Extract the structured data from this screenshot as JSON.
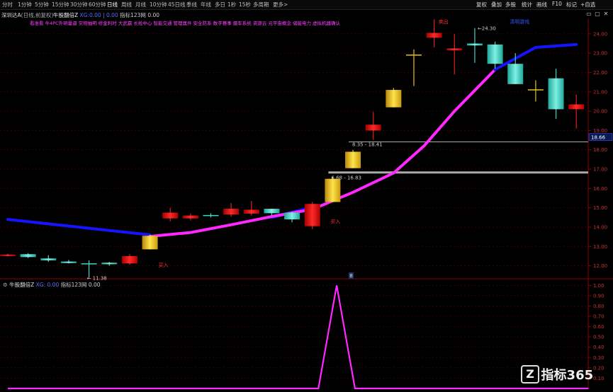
{
  "toolbar": {
    "periods": [
      "分时",
      "1分钟",
      "5分钟",
      "15分钟",
      "30分钟",
      "60分钟",
      "日线",
      "周线",
      "月线",
      "10分钟",
      "45日线",
      "季线",
      "年线",
      "多日",
      "1秒",
      "15秒",
      "多周期",
      "更多>"
    ],
    "active_period": "日线",
    "right_buttons": [
      "复权",
      "叠加",
      "多股",
      "统计",
      "画线",
      "F10",
      "标记",
      "+自选"
    ],
    "window_buttons": [
      "▭",
      "▢",
      "✕"
    ]
  },
  "header": {
    "stock_name": "深圳达A",
    "period_note": "(日线,前复权)",
    "indicator_name": "牛股翻倍Z",
    "indicator_values": "XG:0.00 | 0.00",
    "subindicator": "指标123网",
    "sub_value": "0.00",
    "marquee": "看准看 牛4PC外研量逼 实物抽明 修金利时 大武赢 长抢中心 智能交通 管理属件 安全防系 数字赛事 摄车系统 资源云 元宇宙概念 储能电力 虚拟机器确认"
  },
  "main_axis": {
    "ticks": [
      "24.00",
      "23.00",
      "22.00",
      "21.00",
      "20.00",
      "19.00",
      "18.00",
      "17.00",
      "16.00",
      "15.00",
      "14.00",
      "13.00",
      "12.00"
    ],
    "current_price": "18.66"
  },
  "lower": {
    "title": "牛股翻倍Z",
    "value_text": "XG: 0.00",
    "sub": "指标123网",
    "sub_value": "0.00",
    "ticks": [
      "1.00",
      "0.90",
      "0.80",
      "0.70",
      "0.60",
      "0.50",
      "0.40",
      "0.30",
      "0.20",
      "0.10"
    ]
  },
  "annotations": {
    "low_label": "← 11.38",
    "high_label": "←24.30",
    "range1": "8.35 - 18.41",
    "range2": "6.68 - 16.83",
    "buy1": "买入",
    "buy2": "买入",
    "sell": "卖出",
    "top_note": "清明游戏",
    "center_marker": "8"
  },
  "watermark": {
    "text": "指标365"
  },
  "colors": {
    "up": "#e0201e",
    "down": "#40d6c8",
    "gold": "#e8c21a",
    "trend_blue": "#1414ff",
    "trend_pink": "#ff28ff",
    "axis": "#8b0000"
  },
  "chart_data": {
    "type": "candlestick",
    "ylim": [
      11.4,
      24.8
    ],
    "lower_ylim": [
      0,
      1.05
    ],
    "candles": [
      {
        "o": 12.55,
        "h": 12.62,
        "l": 12.48,
        "c": 12.58,
        "kind": "up"
      },
      {
        "o": 12.6,
        "h": 12.65,
        "l": 12.4,
        "c": 12.45,
        "kind": "down"
      },
      {
        "o": 12.38,
        "h": 12.55,
        "l": 12.2,
        "c": 12.28,
        "kind": "down"
      },
      {
        "o": 12.22,
        "h": 12.3,
        "l": 12.12,
        "c": 12.14,
        "kind": "down"
      },
      {
        "o": 12.12,
        "h": 12.28,
        "l": 11.38,
        "c": 12.1,
        "kind": "doji"
      },
      {
        "o": 12.08,
        "h": 12.2,
        "l": 12.0,
        "c": 12.16,
        "kind": "down"
      },
      {
        "o": 12.12,
        "h": 12.6,
        "l": 12.05,
        "c": 12.5,
        "kind": "up"
      },
      {
        "o": 12.85,
        "h": 13.6,
        "l": 12.85,
        "c": 13.55,
        "kind": "gold"
      },
      {
        "o": 14.75,
        "h": 15.0,
        "l": 14.3,
        "c": 14.45,
        "kind": "up"
      },
      {
        "o": 14.6,
        "h": 14.7,
        "l": 14.35,
        "c": 14.45,
        "kind": "up"
      },
      {
        "o": 14.6,
        "h": 14.72,
        "l": 14.5,
        "c": 14.6,
        "kind": "doji"
      },
      {
        "o": 14.65,
        "h": 15.25,
        "l": 14.55,
        "c": 14.95,
        "kind": "up"
      },
      {
        "o": 14.9,
        "h": 15.35,
        "l": 14.6,
        "c": 14.7,
        "kind": "up"
      },
      {
        "o": 14.95,
        "h": 14.95,
        "l": 14.6,
        "c": 14.72,
        "kind": "down"
      },
      {
        "o": 14.75,
        "h": 14.8,
        "l": 14.25,
        "c": 14.4,
        "kind": "down"
      },
      {
        "o": 15.2,
        "h": 15.3,
        "l": 13.9,
        "c": 14.05,
        "kind": "up"
      },
      {
        "o": 15.3,
        "h": 16.6,
        "l": 15.3,
        "c": 16.5,
        "kind": "gold"
      },
      {
        "o": 17.05,
        "h": 18.0,
        "l": 17.05,
        "c": 17.9,
        "kind": "gold"
      },
      {
        "o": 19.3,
        "h": 19.95,
        "l": 18.5,
        "c": 19.0,
        "kind": "up"
      },
      {
        "o": 20.2,
        "h": 21.2,
        "l": 20.2,
        "c": 21.1,
        "kind": "gold"
      },
      {
        "o": 22.8,
        "h": 23.2,
        "l": 21.3,
        "c": 22.9,
        "kind": "doji"
      },
      {
        "o": 24.05,
        "h": 24.75,
        "l": 23.3,
        "c": 23.8,
        "kind": "up"
      },
      {
        "o": 23.25,
        "h": 24.0,
        "l": 21.9,
        "c": 23.15,
        "kind": "up"
      },
      {
        "o": 23.5,
        "h": 24.3,
        "l": 22.5,
        "c": 23.4,
        "kind": "down"
      },
      {
        "o": 23.45,
        "h": 23.6,
        "l": 22.2,
        "c": 22.45,
        "kind": "down"
      },
      {
        "o": 22.45,
        "h": 23.0,
        "l": 21.5,
        "c": 21.4,
        "kind": "down"
      },
      {
        "o": 21.1,
        "h": 21.6,
        "l": 20.5,
        "c": 21.1,
        "kind": "doji"
      },
      {
        "o": 21.7,
        "h": 22.2,
        "l": 19.6,
        "c": 20.1,
        "kind": "down"
      },
      {
        "o": 20.35,
        "h": 20.85,
        "l": 19.1,
        "c": 20.1,
        "kind": "up"
      }
    ],
    "trend_blue": [
      [
        0,
        14.4
      ],
      [
        7,
        13.6
      ]
    ],
    "trend_blue2": [
      [
        13,
        14.5
      ],
      [
        14.7,
        14.95
      ]
    ],
    "trend_blue3": [
      [
        24,
        22.15
      ],
      [
        26,
        23.3
      ],
      [
        28,
        23.45
      ]
    ],
    "trend_pink": [
      [
        7,
        13.52
      ],
      [
        9,
        13.72
      ],
      [
        11,
        14.12
      ],
      [
        13,
        14.55
      ],
      [
        15,
        14.92
      ],
      [
        17,
        15.8
      ],
      [
        19,
        16.8
      ],
      [
        20.5,
        18.2
      ],
      [
        22,
        20.0
      ],
      [
        24,
        22.15
      ]
    ],
    "signal": [
      [
        0,
        0
      ],
      [
        15.3,
        0
      ],
      [
        16.2,
        1.0
      ],
      [
        17.1,
        0
      ],
      [
        28.6,
        0
      ]
    ]
  }
}
